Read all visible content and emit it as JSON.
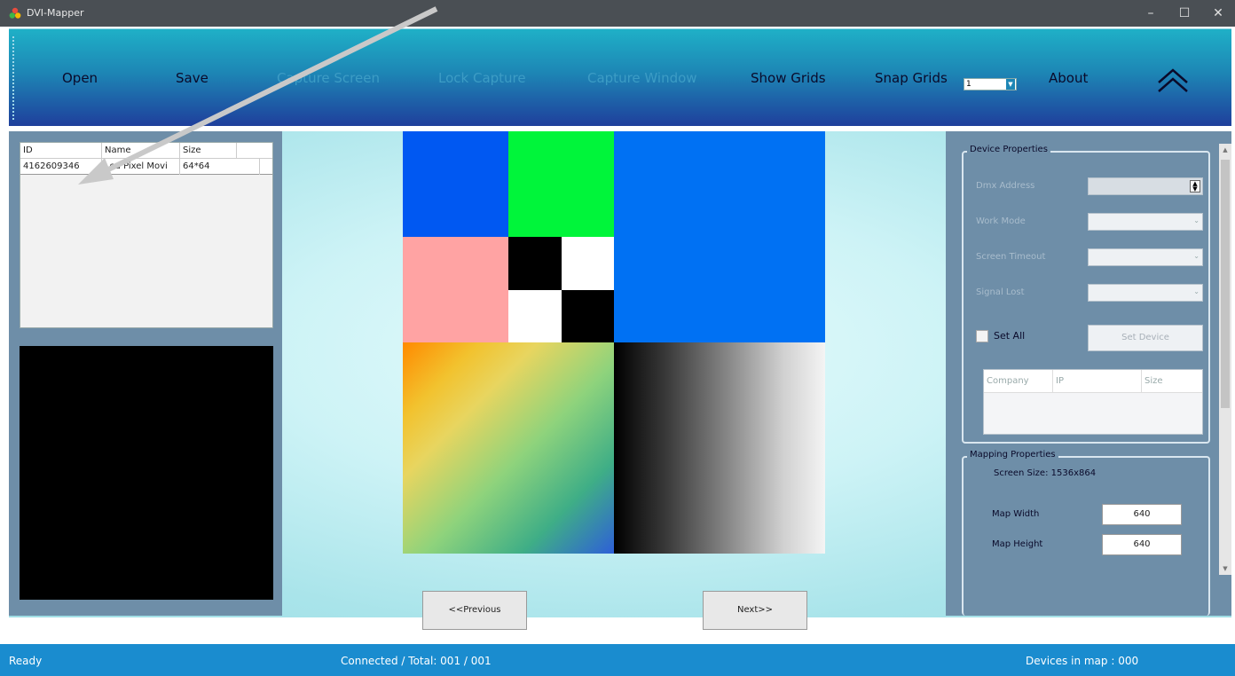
{
  "window": {
    "title": "DVI-Mapper",
    "minimize": "–",
    "maximize": "☐",
    "close": "✕"
  },
  "toolbar": {
    "open": "Open",
    "save": "Save",
    "capture_screen": "Capture Screen",
    "lock_capture": "Lock Capture",
    "capture_window": "Capture Window",
    "show_grids": "Show Grids",
    "snap_grids": "Snap Grids",
    "snap_value": "1",
    "about": "About",
    "disabled_color": "#3c9cc5"
  },
  "device_list": {
    "columns": [
      "ID",
      "Name",
      "Size"
    ],
    "rows": [
      {
        "id": "4162609346",
        "name": "Led Pixel Movi",
        "size": "64*64"
      }
    ]
  },
  "navigation": {
    "previous": "<<Previous",
    "next": "Next>>"
  },
  "device_properties": {
    "title": "Device Properties",
    "dmx_address": "Dmx Address",
    "work_mode": "Work Mode",
    "screen_timeout": "Screen Timeout",
    "signal_lost": "Signal Lost",
    "set_all": "Set All",
    "set_device": "Set Device",
    "company_table": {
      "columns": [
        "Company",
        "IP",
        "Size"
      ]
    }
  },
  "mapping_properties": {
    "title": "Mapping Properties",
    "screen_size": "Screen Size: 1536x864",
    "map_width_label": "Map Width",
    "map_width": "640",
    "map_height_label": "Map Height",
    "map_height": "640"
  },
  "status": {
    "ready": "Ready",
    "connected": "Connected / Total: 001 / 001",
    "devices_in_map": "Devices in map : 000"
  },
  "test_pattern_colors": {
    "blue_top_left": "#0058f2",
    "green": "#00f53a",
    "blue_large": "#0071f3",
    "pink": "#ffa3a3",
    "black": "#000000",
    "white": "#ffffff"
  }
}
